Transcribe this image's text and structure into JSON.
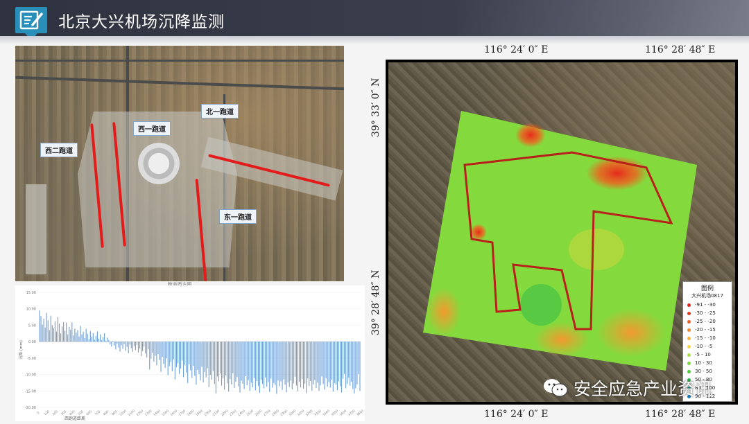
{
  "header": {
    "title": "北京大兴机场沉降监测",
    "logo_icon": "edit-document-icon"
  },
  "left_map": {
    "caption": "跑道西方图",
    "labels": {
      "north": "北一跑道",
      "west1": "西一跑道",
      "west2": "西二跑道",
      "east1": "东一跑道"
    }
  },
  "chart_data": {
    "type": "bar",
    "ylabel": "沉降 (mm)",
    "xlabel": "西跑道距离",
    "ylim": [
      -20,
      15
    ],
    "yticks": [
      "15.00",
      "10.00",
      "5.00",
      "0.00",
      "-5.00",
      "-10.00",
      "-15.00",
      "-20.00"
    ],
    "xticks": [
      "0",
      "100",
      "200",
      "300",
      "400",
      "500",
      "600",
      "700",
      "800",
      "900",
      "1000",
      "1100",
      "1200",
      "1300",
      "1400",
      "1500",
      "1600",
      "1700",
      "1800",
      "1900",
      "2000",
      "2100",
      "2200",
      "2300",
      "2400",
      "2500",
      "2600",
      "2700",
      "2800",
      "2900",
      "3000",
      "3100",
      "3200",
      "3300",
      "3400",
      "3500",
      "3600",
      "3700",
      "3800"
    ],
    "color": "#6d9fd6",
    "values": [
      9.5,
      7.8,
      5.2,
      7.0,
      4.3,
      8.8,
      6.5,
      3.5,
      7.9,
      5.0,
      4.1,
      6.2,
      3.0,
      7.5,
      5.5,
      2.5,
      4.6,
      6.0,
      3.3,
      5.8,
      2.2,
      4.5,
      3.6,
      5.9,
      1.9,
      4.0,
      2.8,
      3.5,
      1.6,
      4.8,
      2.2,
      3.0,
      1.1,
      3.9,
      2.4,
      0.8,
      3.2,
      1.5,
      2.6,
      0.6,
      1.8,
      3.1,
      0.9,
      2.2,
      0.4,
      1.4,
      2.6,
      0.3,
      1.2,
      0.5,
      -0.8,
      -1.5,
      0.2,
      -1.2,
      -2.4,
      -0.6,
      -1.8,
      -3.0,
      -1.1,
      -2.2,
      -0.7,
      -2.8,
      -1.6,
      -3.5,
      -0.9,
      -2.0,
      -3.1,
      -1.4,
      -2.6,
      -1.0,
      -3.3,
      -2.1,
      -4.4,
      -2.9,
      -1.5,
      -3.6,
      -4.8,
      -2.3,
      -8.5,
      -5.2,
      -3.4,
      -6.1,
      -4.3,
      -7.2,
      -3.8,
      -5.6,
      -9.2,
      -4.6,
      -6.8,
      -8.0,
      -5.1,
      -10.2,
      -7.5,
      -6.2,
      -9.0,
      -5.4,
      -11.5,
      -7.8,
      -6.6,
      -9.8,
      -8.2,
      -5.8,
      -10.8,
      -7.1,
      -9.4,
      -12.6,
      -6.9,
      -8.8,
      -11.0,
      -7.4,
      -10.4,
      -13.1,
      -8.6,
      -9.9,
      -11.8,
      -7.7,
      -12.4,
      -9.3,
      -10.9,
      -8.1,
      -13.8,
      -10.1,
      -11.6,
      -9.0,
      -12.9,
      -15.8,
      -10.6,
      -12.1,
      -9.7,
      -13.4,
      -11.2,
      -14.6,
      -10.3,
      -12.7,
      -15.2,
      -11.4,
      -13.0,
      -9.6,
      -14.1,
      -12.2,
      -10.8,
      -13.6,
      -15.5,
      -11.9,
      -12.8,
      -14.4,
      -10.5,
      -13.3,
      -11.7,
      -15.0,
      -12.5,
      -13.9,
      -11.1,
      -14.8,
      -12.0,
      -13.5,
      -15.6,
      -11.6,
      -12.9,
      -14.2,
      -10.9,
      -13.7,
      -12.3,
      -15.3,
      -11.3,
      -14.0,
      -12.6,
      -13.2,
      -15.9,
      -11.8,
      -13.6,
      -12.1,
      -14.7,
      -11.5,
      -13.1,
      -15.4,
      -12.4,
      -13.8,
      -11.9,
      -14.5,
      -12.7,
      -10.7,
      -13.4,
      -15.1,
      -12.2,
      -13.9,
      -11.4,
      -14.3,
      -12.8,
      -15.7,
      -11.2,
      -13.5,
      -12.0,
      -14.9,
      -13.0,
      -11.7,
      -14.1,
      -12.5,
      -15.0,
      -13.3,
      -10.6,
      -12.9,
      -14.6,
      -11.1,
      -13.7,
      -12.3,
      -14.0,
      -11.6,
      -15.2,
      -12.6,
      -13.1,
      -14.8,
      -12.1,
      -13.6,
      -15.5,
      -11.3,
      -9.8,
      -14.2,
      -12.9,
      -11.0,
      -13.4,
      -12.2,
      -14.4,
      -15.8,
      -14.2,
      -13.0,
      -9.9,
      -15.0
    ]
  },
  "right_map": {
    "top_coords": [
      "116° 24′ 0″ E",
      "116° 28′ 48″ E"
    ],
    "bottom_coords": [
      "116° 24′ 0″ E",
      "116° 28′ 48″ E"
    ],
    "left_coords": [
      "39° 33′ 0″ N",
      "39° 28′ 48″ N"
    ],
    "legend": {
      "title": "图例",
      "layer_name": "大兴机场0817",
      "items": [
        {
          "label": "-91 - -30",
          "color": "#e5211d"
        },
        {
          "label": "-30 - -25",
          "color": "#ea3a1f"
        },
        {
          "label": "-25 - -20",
          "color": "#f06025"
        },
        {
          "label": "-20 - -15",
          "color": "#f58a2c"
        },
        {
          "label": "-15 - -10",
          "color": "#f7b135"
        },
        {
          "label": "-10 - -5",
          "color": "#f6d43e"
        },
        {
          "label": "-5 - 10",
          "color": "#a8e13f"
        },
        {
          "label": "10 - 30",
          "color": "#74d93b"
        },
        {
          "label": "30 - 50",
          "color": "#47cf36"
        },
        {
          "label": "50 - 80",
          "color": "#2cb84a"
        },
        {
          "label": "80 - 100",
          "color": "#1e9f8f"
        },
        {
          "label": "90 - 112",
          "color": "#1780c2"
        }
      ]
    }
  },
  "watermark": {
    "text": "安全应急产业资讯",
    "icon": "wechat-icon"
  }
}
